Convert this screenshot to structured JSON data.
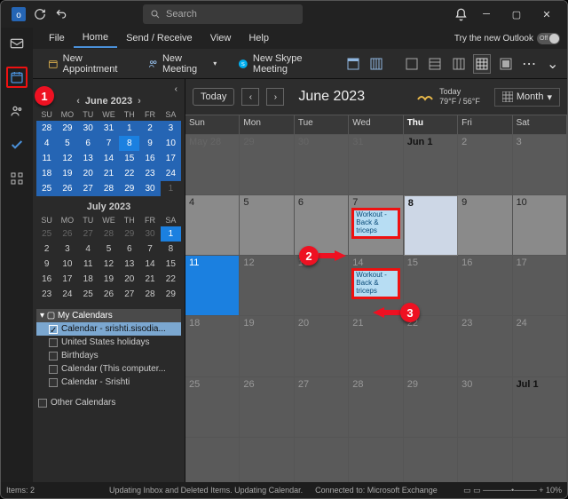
{
  "titlebar": {
    "search_placeholder": "Search"
  },
  "menu": {
    "file": "File",
    "home": "Home",
    "sendrecv": "Send / Receive",
    "view": "View",
    "help": "Help",
    "try": "Try the new Outlook",
    "toggle": "Off"
  },
  "ribbon": {
    "new_appt": "New Appointment",
    "new_meeting": "New Meeting",
    "new_skype": "New Skype Meeting"
  },
  "nav": {
    "month1": "June 2023",
    "month2": "July 2023",
    "dow": [
      "SU",
      "MO",
      "TU",
      "WE",
      "TH",
      "FR",
      "SA"
    ],
    "june_rows": [
      [
        "28",
        "29",
        "30",
        "31",
        "1",
        "2",
        "3"
      ],
      [
        "4",
        "5",
        "6",
        "7",
        "8",
        "9",
        "10"
      ],
      [
        "11",
        "12",
        "13",
        "14",
        "15",
        "16",
        "17"
      ],
      [
        "18",
        "19",
        "20",
        "21",
        "22",
        "23",
        "24"
      ],
      [
        "25",
        "26",
        "27",
        "28",
        "29",
        "30",
        "1"
      ]
    ],
    "july_rows": [
      [
        "25",
        "26",
        "27",
        "28",
        "29",
        "30",
        "1"
      ],
      [
        "2",
        "3",
        "4",
        "5",
        "6",
        "7",
        "8"
      ],
      [
        "9",
        "10",
        "11",
        "12",
        "13",
        "14",
        "15"
      ],
      [
        "16",
        "17",
        "18",
        "19",
        "20",
        "21",
        "22"
      ],
      [
        "23",
        "24",
        "25",
        "26",
        "27",
        "28",
        "29"
      ]
    ],
    "mycal": "My Calendars",
    "cal_items": [
      "Calendar - srishti.sisodia...",
      "United States holidays",
      "Birthdays",
      "Calendar (This computer...",
      "Calendar - Srishti"
    ],
    "other": "Other Calendars"
  },
  "main": {
    "today": "Today",
    "title": "June 2023",
    "weather_day": "Today",
    "weather_temp": "79°F / 56°F",
    "view": "Month",
    "dow": [
      "Sun",
      "Mon",
      "Tue",
      "Wed",
      "Thu",
      "Fri",
      "Sat"
    ],
    "rows": [
      [
        "May 28",
        "29",
        "30",
        "31",
        "Jun 1",
        "2",
        "3"
      ],
      [
        "4",
        "5",
        "6",
        "7",
        "8",
        "9",
        "10"
      ],
      [
        "11",
        "12",
        "13",
        "14",
        "15",
        "16",
        "17"
      ],
      [
        "18",
        "19",
        "20",
        "21",
        "22",
        "23",
        "24"
      ],
      [
        "25",
        "26",
        "27",
        "28",
        "29",
        "30",
        "Jul 1"
      ]
    ],
    "event1": "Workout - Back & triceps",
    "event2": "Workout - Back & triceps"
  },
  "status": {
    "items": "Items: 2",
    "s1": "Updating Inbox and Deleted Items.  Updating Calendar.",
    "s2": "Connected to: Microsoft Exchange",
    "zoom": "10%"
  },
  "anno": {
    "a1": "1",
    "a2": "2",
    "a3": "3"
  }
}
